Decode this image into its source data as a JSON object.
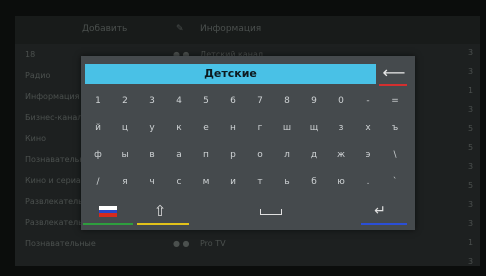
{
  "background": {
    "header": {
      "col1": "Добавить",
      "col2": "Информация"
    },
    "rows": [
      {
        "label": "18",
        "channel": "Детский канал"
      },
      {
        "label": "Радио",
        "channel": ""
      },
      {
        "label": "Информация",
        "channel": ""
      },
      {
        "label": "Бизнес-каналы",
        "channel": ""
      },
      {
        "label": "Кино",
        "channel": ""
      },
      {
        "label": "Познавательные",
        "channel": ""
      },
      {
        "label": "Кино и сериалы",
        "channel": ""
      },
      {
        "label": "Развлекательные",
        "channel": ""
      },
      {
        "label": "Развлекательные",
        "channel": "ТНТ"
      },
      {
        "label": "Познавательные",
        "channel": "Pro TV"
      }
    ],
    "right_numbers": [
      "3",
      "3",
      "1",
      "3",
      "5",
      "5",
      "3",
      "5",
      "3",
      "3",
      "1",
      "3"
    ]
  },
  "keyboard": {
    "input_value": "Детские",
    "backspace_icon": "arrow-left-icon",
    "rows": [
      [
        "1",
        "2",
        "3",
        "4",
        "5",
        "6",
        "7",
        "8",
        "9",
        "0",
        "-",
        "="
      ],
      [
        "й",
        "ц",
        "у",
        "к",
        "е",
        "н",
        "г",
        "ш",
        "щ",
        "з",
        "х",
        "ъ"
      ],
      [
        "ф",
        "ы",
        "в",
        "а",
        "п",
        "р",
        "о",
        "л",
        "д",
        "ж",
        "э",
        "\\"
      ],
      [
        "/",
        "я",
        "ч",
        "с",
        "м",
        "и",
        "т",
        "ь",
        "б",
        "ю",
        ".",
        "`"
      ]
    ],
    "colors": {
      "input_bg": "#49c1e6",
      "red": "#d32f2f",
      "green": "#2e9e3e",
      "yellow": "#e2c21a",
      "blue": "#2b4fd6"
    }
  }
}
